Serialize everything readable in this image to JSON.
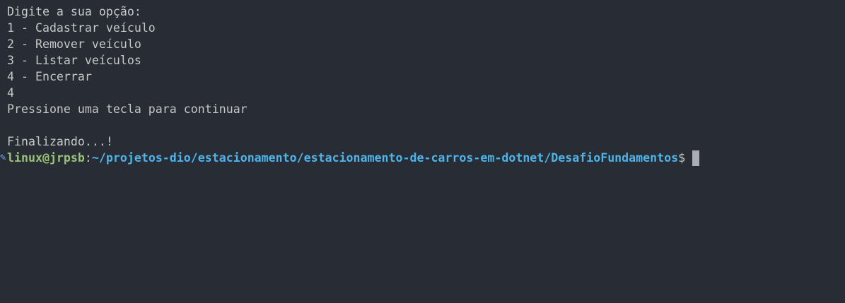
{
  "output_lines": [
    "Digite a sua opção:",
    "1 - Cadastrar veículo",
    "2 - Remover veículo",
    "3 - Listar veículos",
    "4 - Encerrar",
    "4",
    "Pressione uma tecla para continuar",
    "",
    "Finalizando...!"
  ],
  "prompt": {
    "marker": "✎",
    "user_host": "linux@jrpsb",
    "separator": ":",
    "path": "~/projetos-dio/estacionamento/estacionamento-de-carros-em-dotnet/DesafioFundamentos",
    "symbol": "$"
  },
  "colors": {
    "background": "#282c34",
    "text": "#c5c8c6",
    "user_host": "#98c379",
    "path": "#4fb3e8",
    "cursor": "#a9acb3"
  }
}
